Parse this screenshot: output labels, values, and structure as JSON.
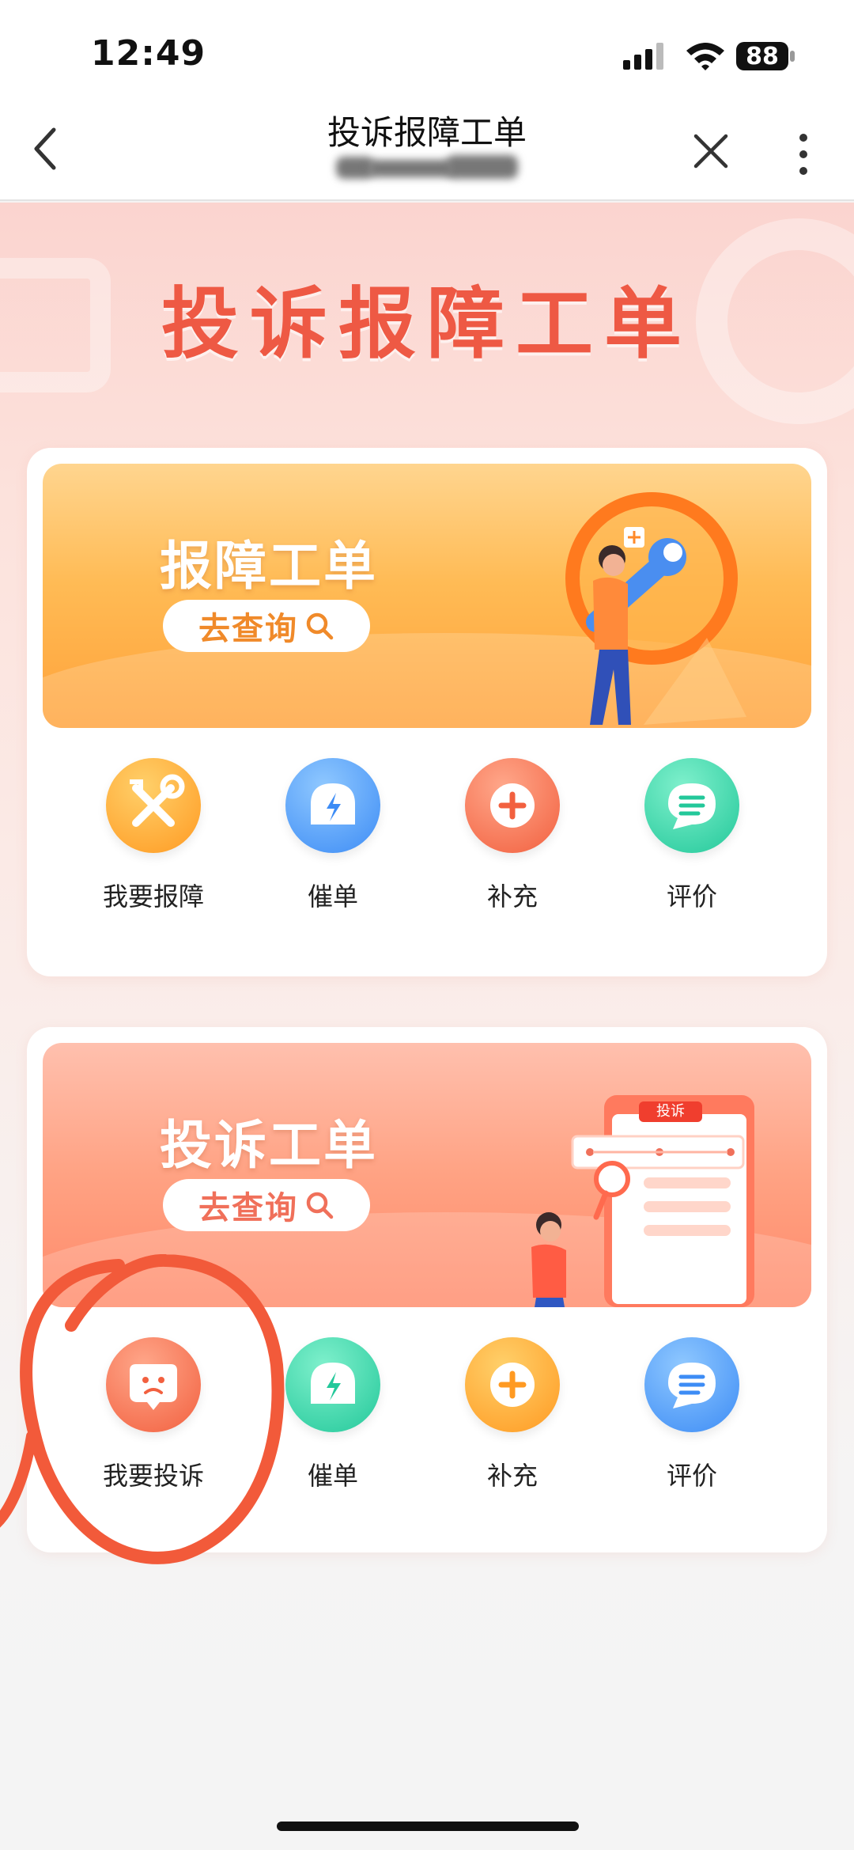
{
  "status_bar": {
    "time": "12:49",
    "battery": "88"
  },
  "nav": {
    "title": "投诉报障工单"
  },
  "hero": {
    "title": "投诉报障工单"
  },
  "repair_section": {
    "banner_title": "报障工单",
    "query_label": "去查询",
    "actions": [
      {
        "label": "我要报障",
        "icon": "tools-icon"
      },
      {
        "label": "催单",
        "icon": "bell-lightning-icon"
      },
      {
        "label": "补充",
        "icon": "plus-icon"
      },
      {
        "label": "评价",
        "icon": "chat-bubble-icon"
      }
    ]
  },
  "complaint_section": {
    "banner_title": "投诉工单",
    "query_label": "去查询",
    "illustration_badge": "投诉",
    "actions": [
      {
        "label": "我要投诉",
        "icon": "sad-face-icon"
      },
      {
        "label": "催单",
        "icon": "bell-lightning-icon"
      },
      {
        "label": "补充",
        "icon": "plus-icon"
      },
      {
        "label": "评价",
        "icon": "chat-bubble-icon"
      }
    ]
  },
  "colors": {
    "accent_red": "#ee5944",
    "orange": "#ffa23a",
    "pink": "#ff8a6a",
    "annotation": "#f25a3a"
  }
}
